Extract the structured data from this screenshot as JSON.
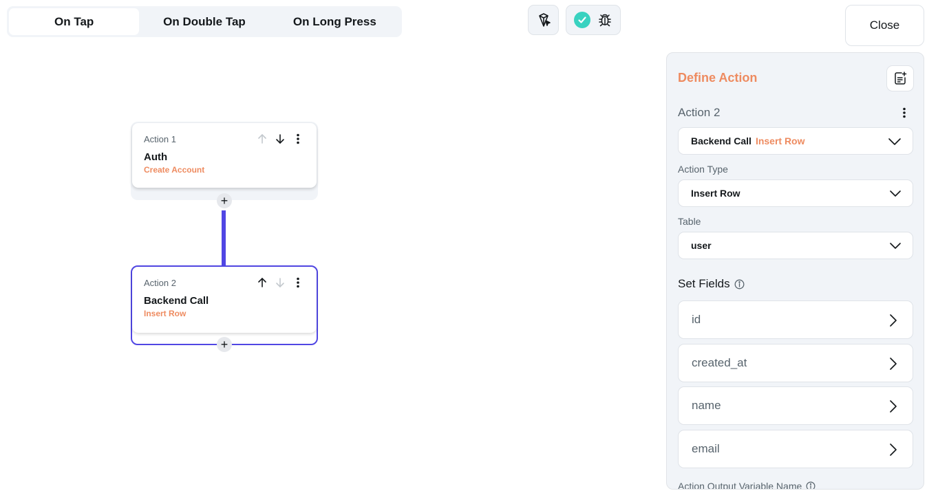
{
  "tabs": [
    {
      "label": "On Tap",
      "active": true
    },
    {
      "label": "On Double Tap",
      "active": false
    },
    {
      "label": "On Long Press",
      "active": false
    }
  ],
  "toolbar": {
    "ai_icon": "magic-cursor-icon",
    "check_icon": "check-icon",
    "debug_icon": "bug-icon"
  },
  "close_label": "Close",
  "canvas": {
    "actions": [
      {
        "label": "Action 1",
        "title": "Auth",
        "subtitle": "Create Account"
      },
      {
        "label": "Action 2",
        "title": "Backend Call",
        "subtitle": "Insert Row"
      }
    ],
    "add_label": "+"
  },
  "panel": {
    "title": "Define Action",
    "action_name": "Action 2",
    "action_select": {
      "main": "Backend Call",
      "sub": "Insert Row"
    },
    "action_type_label": "Action Type",
    "action_type_value": "Insert Row",
    "table_label": "Table",
    "table_value": "user",
    "set_fields_label": "Set Fields",
    "fields": [
      "id",
      "created_at",
      "name",
      "email"
    ],
    "output_label": "Action Output Variable Name"
  },
  "colors": {
    "accent": "#5046e4",
    "orange": "#ee8b60",
    "teal": "#39d2c0",
    "panel_bg": "#f1f4f8"
  }
}
